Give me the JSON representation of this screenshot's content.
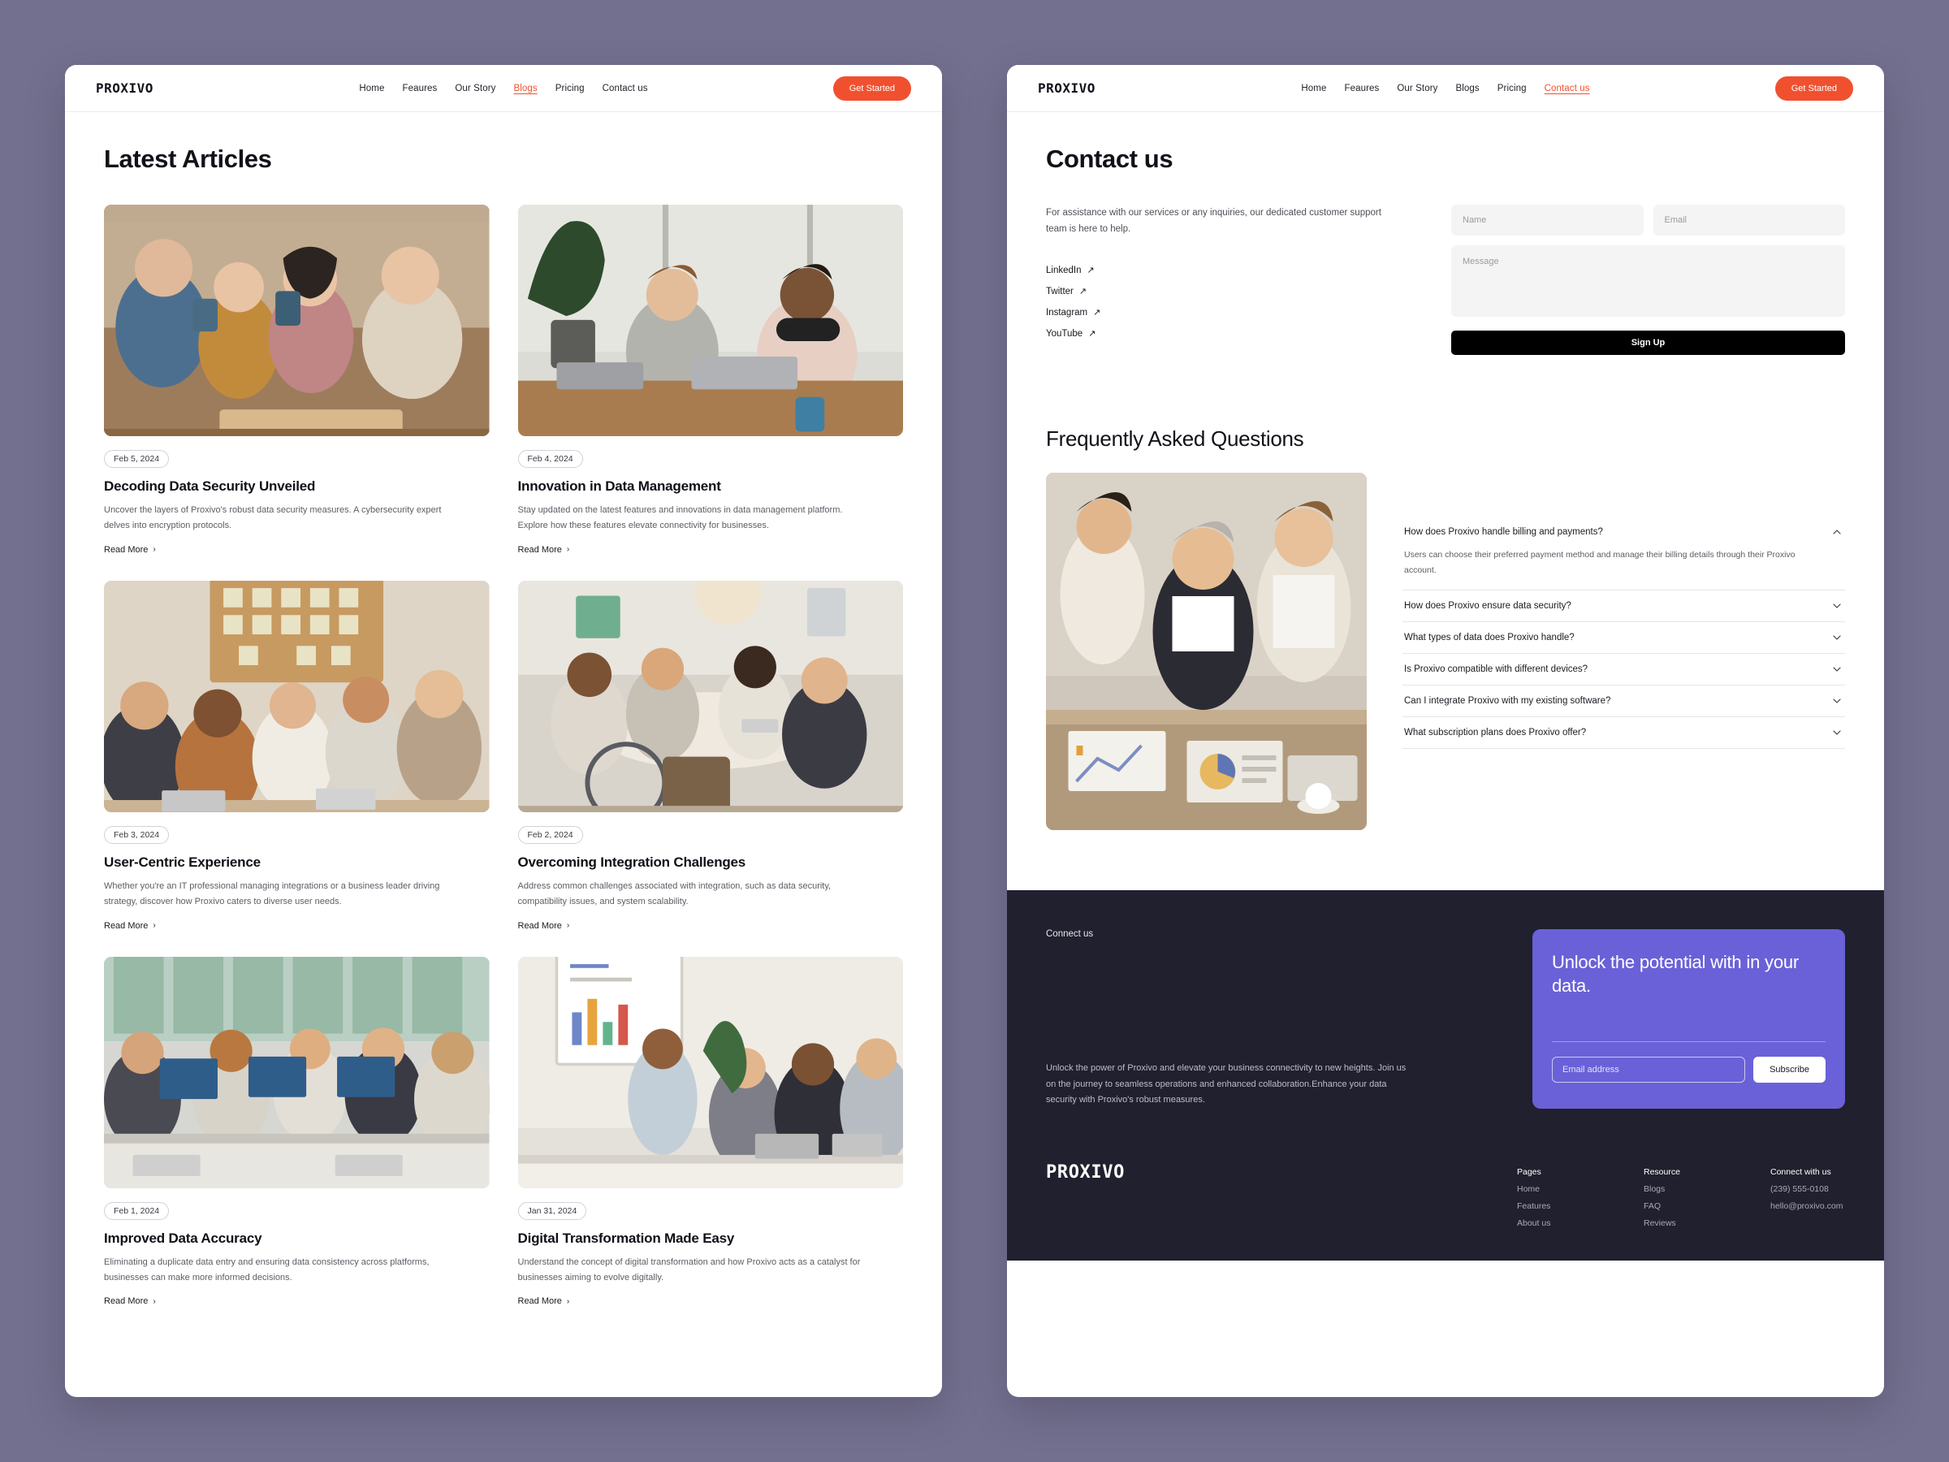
{
  "nav": {
    "brand": "PROXIVO",
    "links": [
      "Home",
      "Feaures",
      "Our Story",
      "Blogs",
      "Pricing",
      "Contact us"
    ],
    "cta": "Get Started"
  },
  "blogs_page": {
    "title": "Latest Articles",
    "read_more": "Read More",
    "articles": [
      {
        "date": "Feb 5, 2024",
        "title": "Decoding Data Security Unveiled",
        "desc": "Uncover the layers of Proxivo's robust data security measures. A cybersecurity expert delves into encryption protocols.",
        "image": "team-coffee-laptop"
      },
      {
        "date": "Feb 4, 2024",
        "title": "Innovation in Data Management",
        "desc": "Stay updated on the latest features and innovations in data management platform. Explore how these features elevate connectivity for businesses.",
        "image": "two-men-laptops-office"
      },
      {
        "date": "Feb 3, 2024",
        "title": "User-Centric Experience",
        "desc": "Whether you're an IT professional managing integrations or a business leader driving strategy, discover how Proxivo caters to diverse user needs.",
        "image": "team-sticky-notes-board"
      },
      {
        "date": "Feb 2, 2024",
        "title": "Overcoming Integration Challenges",
        "desc": "Address common challenges associated with integration, such as data security, compatibility issues, and system scalability.",
        "image": "round-table-meeting"
      },
      {
        "date": "Feb 1, 2024",
        "title": "Improved Data Accuracy",
        "desc": "Eliminating a duplicate data entry and ensuring data consistency across platforms, businesses can make more informed decisions.",
        "image": "open-office-desktops"
      },
      {
        "date": "Jan 31, 2024",
        "title": "Digital Transformation Made Easy",
        "desc": "Understand the concept of digital transformation and how Proxivo acts as a catalyst for businesses aiming to evolve digitally.",
        "image": "whiteboard-presentation"
      }
    ]
  },
  "contact_page": {
    "title": "Contact us",
    "intro": "For assistance with our services or any inquiries, our dedicated customer support team is here to help.",
    "socials": [
      "LinkedIn",
      "Twitter",
      "Instagram",
      "YouTube"
    ],
    "form": {
      "name_placeholder": "Name",
      "email_placeholder": "Email",
      "message_placeholder": "Message",
      "submit_label": "Sign Up"
    },
    "faq": {
      "title": "Frequently Asked Questions",
      "image": "business-team-reviewing-charts",
      "items": [
        {
          "question": "How does Proxivo handle billing and payments?",
          "answer": "Users can choose their preferred payment method and manage their billing details through their Proxivo account.",
          "open": true
        },
        {
          "question": "How does Proxivo ensure data security?",
          "answer": "",
          "open": false
        },
        {
          "question": "What types of data does Proxivo handle?",
          "answer": "",
          "open": false
        },
        {
          "question": "Is Proxivo compatible with different devices?",
          "answer": "",
          "open": false
        },
        {
          "question": "Can I integrate Proxivo with my existing software?",
          "answer": "",
          "open": false
        },
        {
          "question": "What subscription plans does Proxivo offer?",
          "answer": "",
          "open": false
        }
      ]
    },
    "footer": {
      "connect_label": "Connect us",
      "description": "Unlock the power of Proxivo and elevate your business connectivity to new heights. Join us on the journey to seamless operations and enhanced collaboration.Enhance your data security with Proxivo's robust measures.",
      "cta_card": {
        "title": "Unlock the potential with in your data.",
        "email_placeholder": "Email address",
        "subscribe_label": "Subscribe",
        "background_color": "#6a61d8"
      },
      "brand": "PROXIVO",
      "columns": [
        {
          "head": "Pages",
          "links": [
            "Home",
            "Features",
            "About us"
          ]
        },
        {
          "head": "Resource",
          "links": [
            "Blogs",
            "FAQ",
            "Reviews"
          ]
        },
        {
          "head": "Connect with us",
          "links": [
            "(239) 555-0108",
            "hello@proxivo.com"
          ]
        }
      ]
    }
  },
  "colors": {
    "accent": "#f1502f",
    "footer_bg": "#20202e",
    "cta_purple": "#6a61d8",
    "page_bg": "#73708f"
  }
}
